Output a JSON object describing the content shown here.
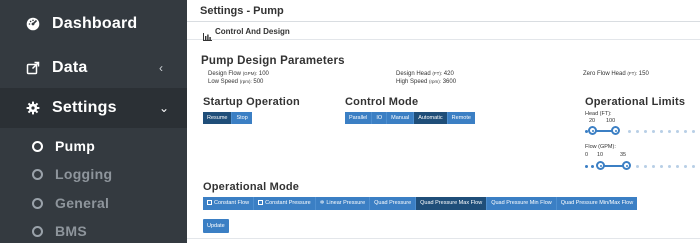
{
  "sidebar": {
    "items": [
      {
        "label": "Dashboard",
        "icon": "dashboard-icon"
      },
      {
        "label": "Data",
        "icon": "external-link-icon",
        "chevron": "‹"
      },
      {
        "label": "Settings",
        "icon": "gear-icon",
        "chevron": "⌄"
      }
    ],
    "subitems": [
      {
        "label": "Pump",
        "active": true
      },
      {
        "label": "Logging",
        "active": false
      },
      {
        "label": "General",
        "active": false
      },
      {
        "label": "BMS",
        "active": false
      }
    ]
  },
  "header": {
    "title": "Settings - Pump"
  },
  "card": {
    "title": "Control And Design"
  },
  "pump_design": {
    "title": "Pump Design Parameters",
    "design_flow": {
      "label": "Design Flow",
      "unit": "(GPM):",
      "value": "100"
    },
    "low_speed": {
      "label": "Low Speed",
      "unit": "(rpm):",
      "value": "500"
    },
    "design_head": {
      "label": "Design Head",
      "unit": "(FT):",
      "value": "420"
    },
    "high_speed": {
      "label": "High Speed",
      "unit": "(rpm):",
      "value": "3600"
    },
    "zero_flow_head": {
      "label": "Zero Flow Head",
      "unit": "(FT):",
      "value": "150"
    }
  },
  "startup": {
    "title": "Startup Operation",
    "buttons": [
      "Resume",
      "Stop"
    ],
    "active": "Resume"
  },
  "control_mode": {
    "title": "Control Mode",
    "buttons": [
      "Parallel",
      "IO",
      "Manual",
      "Automatic",
      "Remote"
    ],
    "active": "Automatic"
  },
  "limits": {
    "title": "Operational Limits",
    "head": {
      "label": "Head (FT):",
      "min": "20",
      "max": "100"
    },
    "flow": {
      "label": "Flow (GPM):",
      "min": "0",
      "mid": "10",
      "max": "35"
    }
  },
  "operational_mode": {
    "title": "Operational Mode",
    "buttons": [
      "Constant Flow",
      "Constant Pressure",
      "Linear Pressure",
      "Quad Pressure",
      "Quad Pressure Max Flow",
      "Quad Pressure Min Flow",
      "Quad Pressure Min/Max Flow"
    ],
    "active": "Quad Pressure Max Flow"
  },
  "update_label": "Update",
  "colors": {
    "sidebar": "#343a40",
    "primary": "#3b7fc4",
    "active": "#1f4e79"
  }
}
